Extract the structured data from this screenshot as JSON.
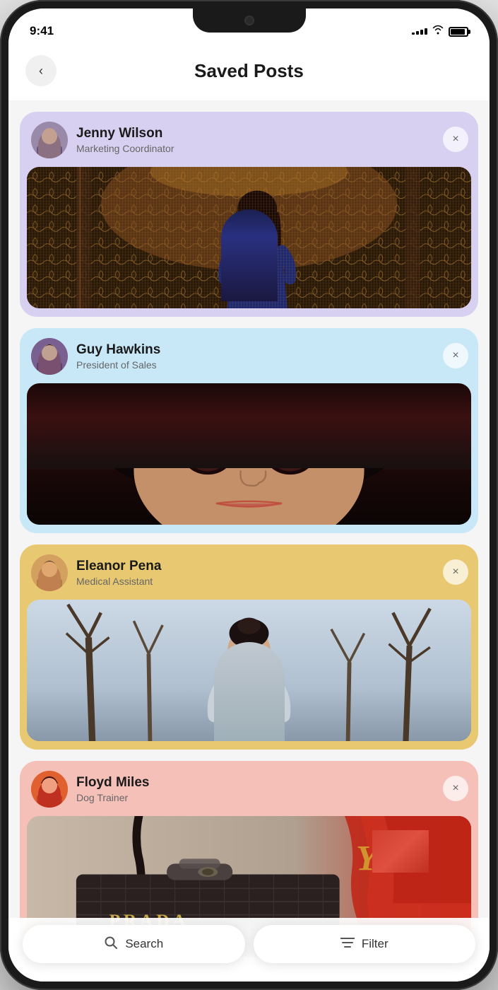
{
  "statusBar": {
    "time": "9:41",
    "signalBars": [
      3,
      5,
      7,
      9,
      11
    ],
    "batteryLevel": 90
  },
  "header": {
    "backLabel": "<",
    "title": "Saved Posts"
  },
  "posts": [
    {
      "id": "post-1",
      "cardColor": "#d8d0f0",
      "user": {
        "name": "Jenny Wilson",
        "role": "Marketing Coordinator",
        "avatarClass": "avatar-jenny"
      }
    },
    {
      "id": "post-2",
      "cardColor": "#c8e8f8",
      "user": {
        "name": "Guy Hawkins",
        "role": "President of Sales",
        "avatarClass": "avatar-guy"
      }
    },
    {
      "id": "post-3",
      "cardColor": "#e8c870",
      "user": {
        "name": "Eleanor Pena",
        "role": "Medical Assistant",
        "avatarClass": "avatar-eleanor"
      }
    },
    {
      "id": "post-4",
      "cardColor": "#f4c0b8",
      "user": {
        "name": "Floyd Miles",
        "role": "Dog Trainer",
        "avatarClass": "avatar-floyd"
      }
    }
  ],
  "bottomBar": {
    "searchLabel": "Search",
    "filterLabel": "Filter",
    "searchIconUnicode": "🔍",
    "filterIconUnicode": "≡"
  }
}
